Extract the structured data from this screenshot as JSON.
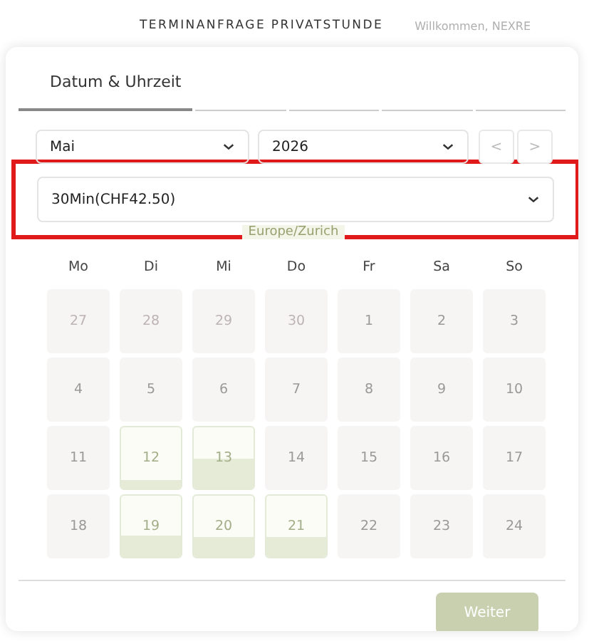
{
  "header": {
    "title": "TERMINANFRAGE PRIVATSTUNDE",
    "greeting": "Willkommen, NEXRE"
  },
  "tabs": [
    {
      "label": "Datum & Uhrzeit",
      "selected": true
    },
    {
      "selected": false
    },
    {
      "selected": false
    },
    {
      "selected": false
    },
    {
      "selected": false
    }
  ],
  "month_select": {
    "value": "Mai"
  },
  "year_select": {
    "value": "2026"
  },
  "nav_buttons": [
    "<",
    ">"
  ],
  "duration_select": {
    "value": "30Min(CHF42.50)",
    "highlighted": true
  },
  "timezone": "Europe/Zurich",
  "weekdays": [
    "Mo",
    "Di",
    "Mi",
    "Do",
    "Fr",
    "Sa",
    "So"
  ],
  "days": [
    {
      "label": "27",
      "muted": true
    },
    {
      "label": "28",
      "muted": true
    },
    {
      "label": "29",
      "muted": true
    },
    {
      "label": "30",
      "muted": true
    },
    {
      "label": "1",
      "muted": false
    },
    {
      "label": "2",
      "muted": false
    },
    {
      "label": "3",
      "muted": false
    },
    {
      "label": "4",
      "muted": false
    },
    {
      "label": "5",
      "muted": false
    },
    {
      "label": "6",
      "muted": false
    },
    {
      "label": "7",
      "muted": false
    },
    {
      "label": "8",
      "muted": false
    },
    {
      "label": "9",
      "muted": false
    },
    {
      "label": "10",
      "muted": false
    },
    {
      "label": "11",
      "muted": false
    },
    {
      "label": "12",
      "muted": false,
      "level": 0.15
    },
    {
      "label": "13",
      "muted": false,
      "level": 0.5
    },
    {
      "label": "14",
      "muted": false
    },
    {
      "label": "15",
      "muted": false
    },
    {
      "label": "16",
      "muted": false
    },
    {
      "label": "17",
      "muted": false
    },
    {
      "label": "18",
      "muted": false
    },
    {
      "label": "19",
      "muted": false,
      "level": 0.35
    },
    {
      "label": "20",
      "muted": false,
      "level": 0.32
    },
    {
      "label": "21",
      "muted": false,
      "level": 0.32
    },
    {
      "label": "22",
      "muted": false
    },
    {
      "label": "23",
      "muted": false
    },
    {
      "label": "24",
      "muted": false
    }
  ],
  "next_button": {
    "label": "Weiter",
    "disabled": true
  }
}
